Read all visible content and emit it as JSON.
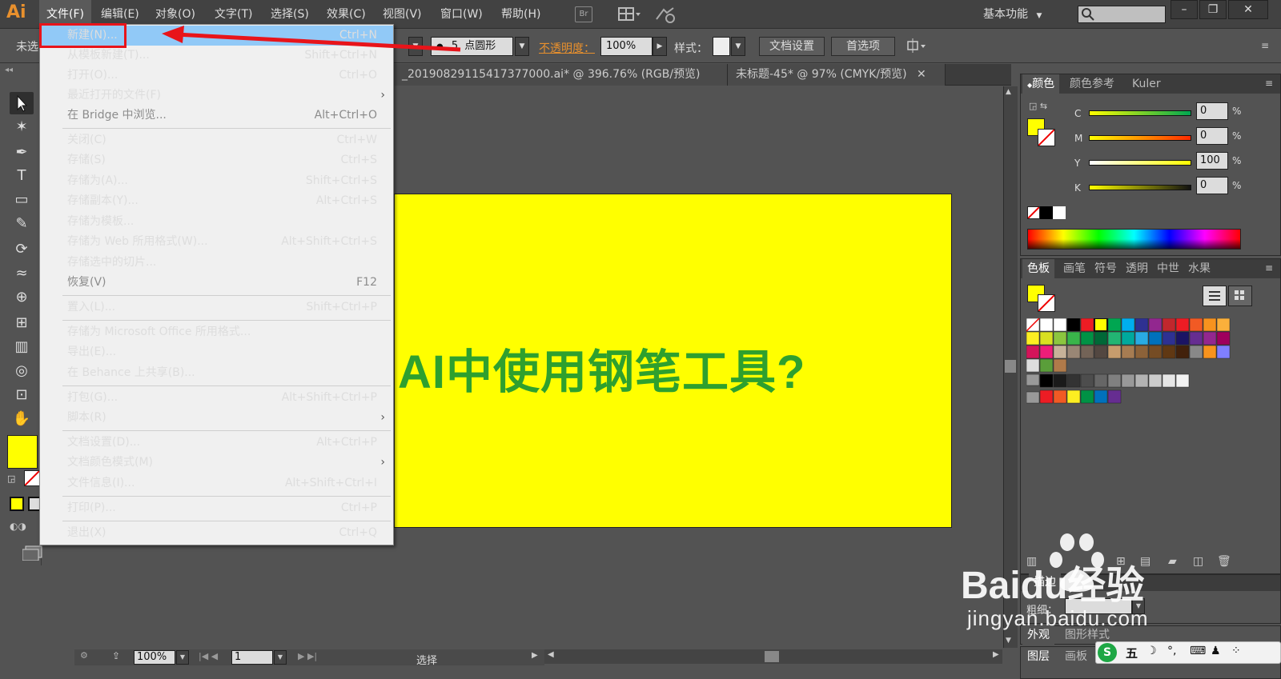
{
  "app": {
    "logo": "Ai",
    "menus": [
      "文件(F)",
      "编辑(E)",
      "对象(O)",
      "文字(T)",
      "选择(S)",
      "效果(C)",
      "视图(V)",
      "窗口(W)",
      "帮助(H)"
    ],
    "bridge_label": "Br",
    "workspace": "基本功能"
  },
  "control_bar": {
    "selection_text": "未选",
    "brush_size": "5",
    "brush_shape": "点圆形",
    "opacity_label": "不透明度：",
    "opacity_value": "100%",
    "style_label": "样式：",
    "doc_setup_button": "文档设置",
    "prefs_button": "首选项"
  },
  "tabs": [
    {
      "label": "_20190829115417377000.ai* @ 396.76% (RGB/预览)"
    },
    {
      "label": "未标题-45* @ 97% (CMYK/预览)"
    }
  ],
  "artboard": {
    "text": "AI中使用钢笔工具?",
    "bg": "#ffff00",
    "text_color": "#2ea02e"
  },
  "file_menu": {
    "items": [
      {
        "label": "新建(N)...",
        "shortcut": "Ctrl+N",
        "highlight": true
      },
      {
        "label": "从模板新建(T)...",
        "shortcut": "Shift+Ctrl+N"
      },
      {
        "label": "打开(O)...",
        "shortcut": "Ctrl+O"
      },
      {
        "label": "最近打开的文件(F)",
        "shortcut": "",
        "submenu": true
      },
      {
        "label": "在 Bridge 中浏览...",
        "shortcut": "Alt+Ctrl+O",
        "disabled": true
      },
      {
        "label": "关闭(C)",
        "shortcut": "Ctrl+W"
      },
      {
        "label": "存储(S)",
        "shortcut": "Ctrl+S"
      },
      {
        "label": "存储为(A)...",
        "shortcut": "Shift+Ctrl+S"
      },
      {
        "label": "存储副本(Y)...",
        "shortcut": "Alt+Ctrl+S"
      },
      {
        "label": "存储为模板...",
        "shortcut": ""
      },
      {
        "label": "存储为 Web 所用格式(W)...",
        "shortcut": "Alt+Shift+Ctrl+S"
      },
      {
        "label": "存储选中的切片...",
        "shortcut": ""
      },
      {
        "label": "恢复(V)",
        "shortcut": "F12",
        "disabled": true
      },
      {
        "label": "置入(L)...",
        "shortcut": "Shift+Ctrl+P"
      },
      {
        "label": "存储为 Microsoft Office 所用格式...",
        "shortcut": ""
      },
      {
        "label": "导出(E)...",
        "shortcut": ""
      },
      {
        "label": "在 Behance 上共享(B)...",
        "shortcut": ""
      },
      {
        "label": "打包(G)...",
        "shortcut": "Alt+Shift+Ctrl+P"
      },
      {
        "label": "脚本(R)",
        "shortcut": "",
        "submenu": true
      },
      {
        "label": "文档设置(D)...",
        "shortcut": "Alt+Ctrl+P"
      },
      {
        "label": "文档颜色模式(M)",
        "shortcut": "",
        "submenu": true
      },
      {
        "label": "文件信息(I)...",
        "shortcut": "Alt+Shift+Ctrl+I"
      },
      {
        "label": "打印(P)...",
        "shortcut": "Ctrl+P"
      },
      {
        "label": "退出(X)",
        "shortcut": "Ctrl+Q"
      }
    ],
    "submenu_glyph": "›"
  },
  "color_panel": {
    "tabs": [
      "颜色",
      "颜色参考",
      "Kuler"
    ],
    "channels": [
      {
        "name": "C",
        "value": "0"
      },
      {
        "name": "M",
        "value": "0"
      },
      {
        "name": "Y",
        "value": "100"
      },
      {
        "name": "K",
        "value": "0"
      }
    ],
    "percent": "%"
  },
  "swatches_panel": {
    "tabs": [
      "色板",
      "画笔",
      "符号",
      "透明",
      "中世",
      "水果"
    ]
  },
  "stroke_panel": {
    "tab": "描边",
    "weight_label": "粗细："
  },
  "appearance_panel": {
    "tabs": [
      "外观",
      "图形样式"
    ]
  },
  "layers_panel": {
    "tabs": [
      "图层",
      "画板"
    ]
  },
  "status_bar": {
    "zoom": "100%",
    "page": "1",
    "tool": "选择"
  },
  "watermark": {
    "brand": "Baidu经验",
    "url": "jingyan.baidu.com"
  },
  "ime_bar": {
    "text": "五"
  }
}
